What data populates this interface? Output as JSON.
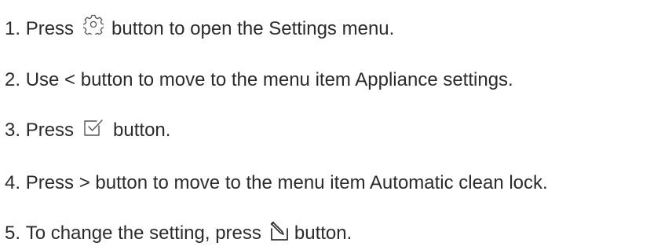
{
  "steps": [
    {
      "number": "1.",
      "before": "Press",
      "icon": "gear-icon",
      "after": "button to open the Settings menu."
    },
    {
      "number": "2.",
      "text": "Use < button to move to the menu item Appliance settings."
    },
    {
      "number": "3.",
      "before": "Press",
      "icon": "checkbox-check-icon",
      "after": "button."
    },
    {
      "number": "4.",
      "text": "Press > button to move to the menu item Automatic clean lock."
    },
    {
      "number": "5.",
      "before": "To change the setting, press",
      "icon": "edit-pencil-icon",
      "after": "button."
    }
  ]
}
